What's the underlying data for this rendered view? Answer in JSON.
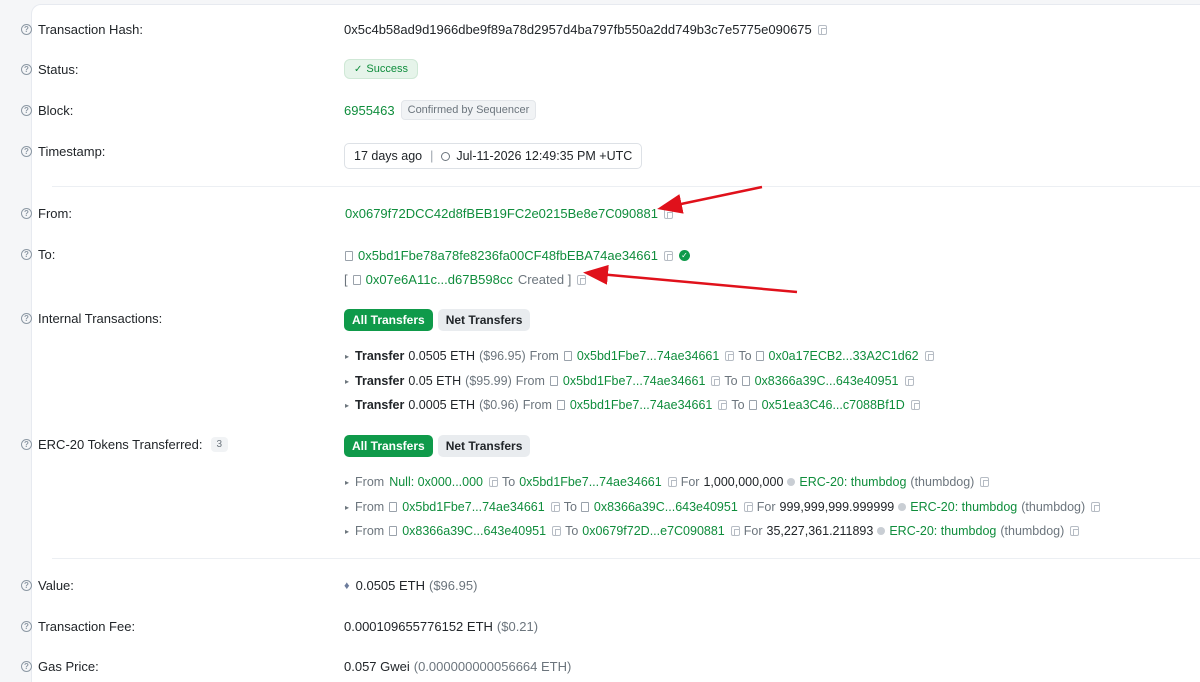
{
  "tx": {
    "hash_label": "Transaction Hash:",
    "hash": "0x5c4b58ad9d1966dbe9f89a78d2957d4ba797fb550a2dd749b3c7e5775e090675",
    "status_label": "Status:",
    "status": "Success",
    "block_label": "Block:",
    "block": "6955463",
    "block_badge": "Confirmed by Sequencer",
    "timestamp_label": "Timestamp:",
    "timestamp_ago": "17 days ago",
    "timestamp_full": "Jul-11-2026 12:49:35 PM +UTC",
    "from_label": "From:",
    "from": "0x0679f72DCC42d8fBEB19FC2e0215Be8e7C090881",
    "to_label": "To:",
    "to": "0x5bd1Fbe78a78fe8236fa00CF48fbEBA74ae34661",
    "created_open": "[",
    "created_addr": "0x07e6A11c...d67B598cc",
    "created_text": "Created ]",
    "internal_label": "Internal Transactions:",
    "erc20_label": "ERC-20 Tokens Transferred:",
    "erc20_count": "3",
    "value_label": "Value:",
    "value": "0.0505 ETH",
    "value_usd": "($96.95)",
    "fee_label": "Transaction Fee:",
    "fee": "0.000109655776152 ETH",
    "fee_usd": "($0.21)",
    "gas_label": "Gas Price:",
    "gas": "0.057 Gwei",
    "gas_eth": "(0.000000000056664 ETH)"
  },
  "buttons": {
    "all": "All Transfers",
    "net": "Net Transfers"
  },
  "words": {
    "transfer": "Transfer",
    "from": "From",
    "to": "To",
    "for": "For"
  },
  "internal": [
    {
      "amount": "0.0505 ETH",
      "usd": "($96.95)",
      "from": "0x5bd1Fbe7...74ae34661",
      "to": "0x0a17ECB2...33A2C1d62"
    },
    {
      "amount": "0.05 ETH",
      "usd": "($95.99)",
      "from": "0x5bd1Fbe7...74ae34661",
      "to": "0x8366a39C...643e40951"
    },
    {
      "amount": "0.0005 ETH",
      "usd": "($0.96)",
      "from": "0x5bd1Fbe7...74ae34661",
      "to": "0x51ea3C46...c7088Bf1D"
    }
  ],
  "erc20": [
    {
      "from": "Null: 0x000...000",
      "to": "0x5bd1Fbe7...74ae34661",
      "amount": "1,000,000,000",
      "token": "ERC-20: thumbdog",
      "symbol": "(thumbdog)"
    },
    {
      "from": "0x5bd1Fbe7...74ae34661",
      "to": "0x8366a39C...643e40951",
      "amount": "999,999,999.999999",
      "token": "ERC-20: thumbdog",
      "symbol": "(thumbdog)"
    },
    {
      "from": "0x8366a39C...643e40951",
      "to": "0x0679f72D...e7C090881",
      "amount": "35,227,361.211893",
      "token": "ERC-20: thumbdog",
      "symbol": "(thumbdog)"
    }
  ],
  "colors": {
    "accent": "#0f9a4a",
    "link": "#0f8d3c",
    "arrow": "#e0111b"
  }
}
